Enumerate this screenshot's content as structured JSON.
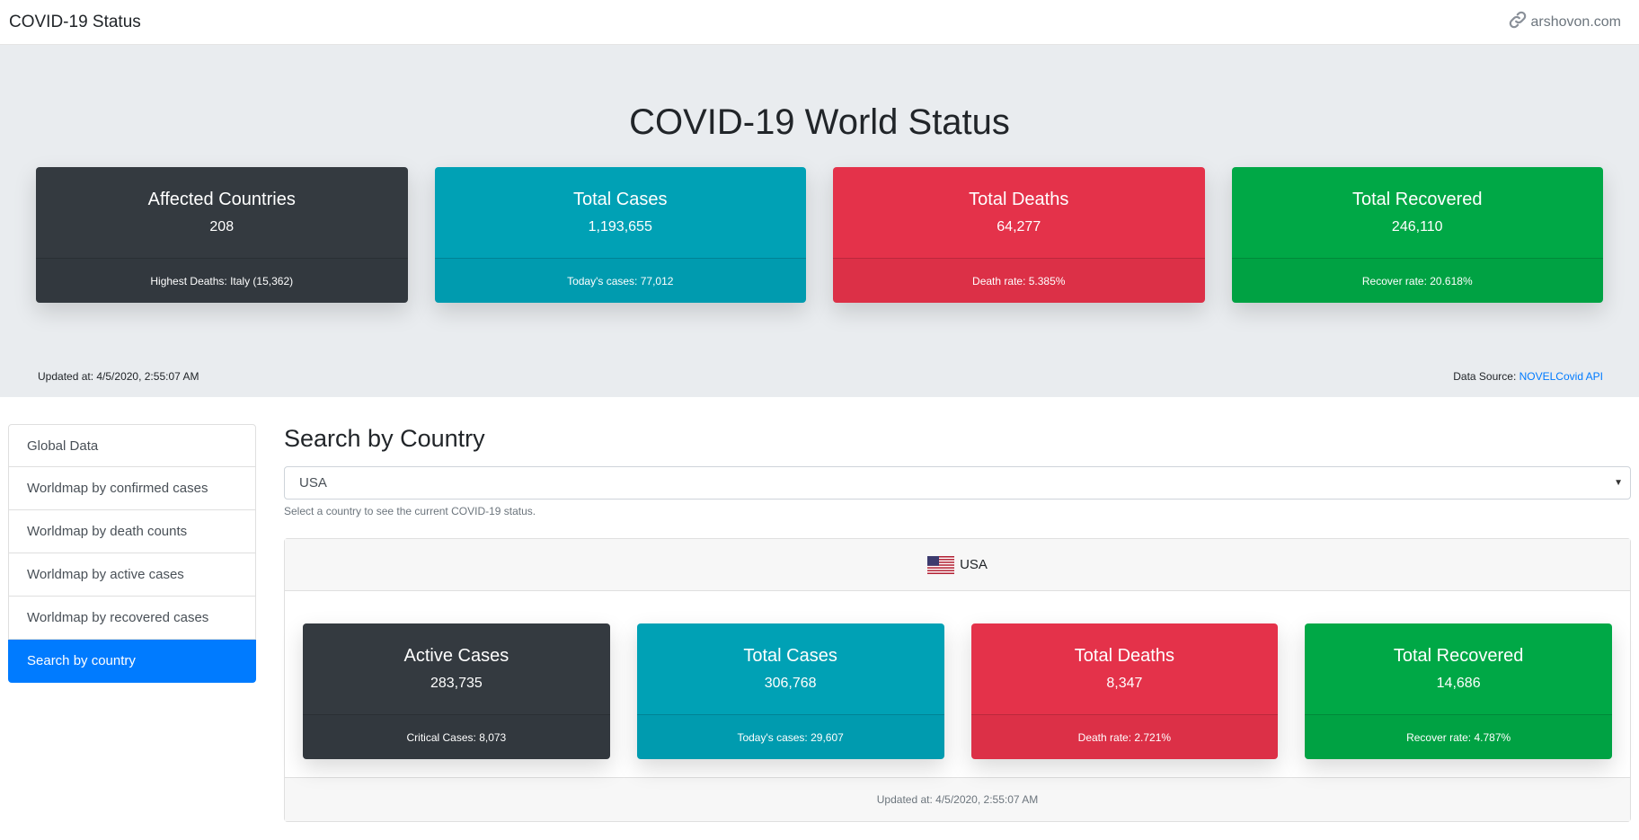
{
  "navbar": {
    "brand": "COVID-19 Status",
    "site_link": "arshovon.com",
    "link_icon": "link-icon"
  },
  "world": {
    "title": "COVID-19 World Status",
    "cards": [
      {
        "title": "Affected Countries",
        "value": "208",
        "footer": "Highest Deaths: Italy (15,362)",
        "color": "#343a40"
      },
      {
        "title": "Total Cases",
        "value": "1,193,655",
        "footer": "Today's cases: 77,012",
        "color": "#00a1b5"
      },
      {
        "title": "Total Deaths",
        "value": "64,277",
        "footer": "Death rate: 5.385%",
        "color": "#e4324a"
      },
      {
        "title": "Total Recovered",
        "value": "246,110",
        "footer": "Recover rate: 20.618%",
        "color": "#00a846"
      }
    ],
    "updated": "Updated at: 4/5/2020, 2:55:07 AM",
    "source_label": "Data Source: ",
    "source_link": "NOVELCovid API"
  },
  "sidebar": {
    "items": [
      {
        "label": "Global Data"
      },
      {
        "label": "Worldmap by confirmed cases"
      },
      {
        "label": "Worldmap by death counts"
      },
      {
        "label": "Worldmap by active cases"
      },
      {
        "label": "Worldmap by recovered cases"
      },
      {
        "label": "Search by country",
        "active": true
      }
    ]
  },
  "search": {
    "title": "Search by Country",
    "selected": "USA",
    "help": "Select a country to see the current COVID-19 status."
  },
  "country": {
    "name": "USA",
    "flag_icon": "us-flag-icon",
    "cards": [
      {
        "title": "Active Cases",
        "value": "283,735",
        "footer": "Critical Cases: 8,073",
        "color": "#343a40"
      },
      {
        "title": "Total Cases",
        "value": "306,768",
        "footer": "Today's cases: 29,607",
        "color": "#00a1b5"
      },
      {
        "title": "Total Deaths",
        "value": "8,347",
        "footer": "Death rate: 2.721%",
        "color": "#e4324a"
      },
      {
        "title": "Total Recovered",
        "value": "14,686",
        "footer": "Recover rate: 4.787%",
        "color": "#00a846"
      }
    ],
    "updated": "Updated at: 4/5/2020, 2:55:07 AM"
  },
  "colors": {
    "accent": "#007bff",
    "jumbotron_bg": "#e9ecef"
  }
}
